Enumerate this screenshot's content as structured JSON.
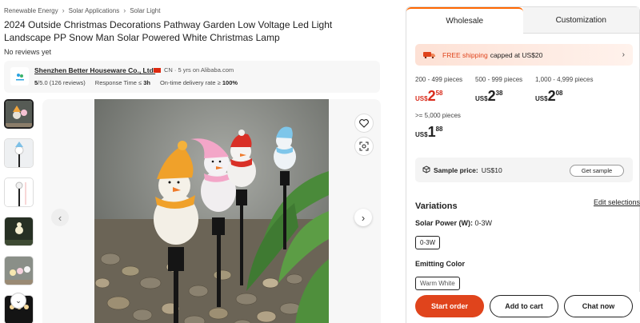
{
  "breadcrumb": [
    "Renewable Energy",
    "Solar Applications",
    "Solar Light"
  ],
  "product": {
    "title": "2024 Outside Christmas Decorations Pathway Garden Low Voltage Led Light Landscape PP Snow Man Solar Powered White Christmas Lamp",
    "reviews": "No reviews yet"
  },
  "supplier": {
    "name": "Shenzhen Better Houseware Co., Ltd.",
    "meta": "CN · 5 yrs on Alibaba.com",
    "rating_value": "5",
    "rating_rest": "/5.0 (126 reviews)",
    "response_label": "Response Time ≤",
    "response_value": "3h",
    "ontime_label": "On-time delivery rate ≥",
    "ontime_value": "100%"
  },
  "tabs": {
    "wholesale": "Wholesale",
    "customization": "Customization"
  },
  "shipping": {
    "free": "FREE shipping",
    "rest": "capped at US$20"
  },
  "tiers": [
    {
      "range": "200 - 499 pieces",
      "currency": "US$",
      "int": "2",
      "dec": "58",
      "highlight": true
    },
    {
      "range": "500 - 999 pieces",
      "currency": "US$",
      "int": "2",
      "dec": "38",
      "highlight": false
    },
    {
      "range": "1,000 - 4,999 pieces",
      "currency": "US$",
      "int": "2",
      "dec": "08",
      "highlight": false
    },
    {
      "range": ">= 5,000 pieces",
      "currency": "US$",
      "int": "1",
      "dec": "88",
      "highlight": false
    }
  ],
  "sample": {
    "label": "Sample price:",
    "value": "US$10",
    "button": "Get sample"
  },
  "variations": {
    "heading": "Variations",
    "edit": "Edit selections",
    "solar_label": "Solar Power (W):",
    "solar_value": "0-3W",
    "solar_chip": "0-3W",
    "emit_label": "Emitting Color",
    "emit_chip": "Warm White"
  },
  "actions": {
    "start": "Start order",
    "cart": "Add to cart",
    "chat": "Chat now"
  },
  "colors": {
    "accent": "#e0441c",
    "price_red": "#d92b1b",
    "tab_orange": "#ff6600"
  }
}
